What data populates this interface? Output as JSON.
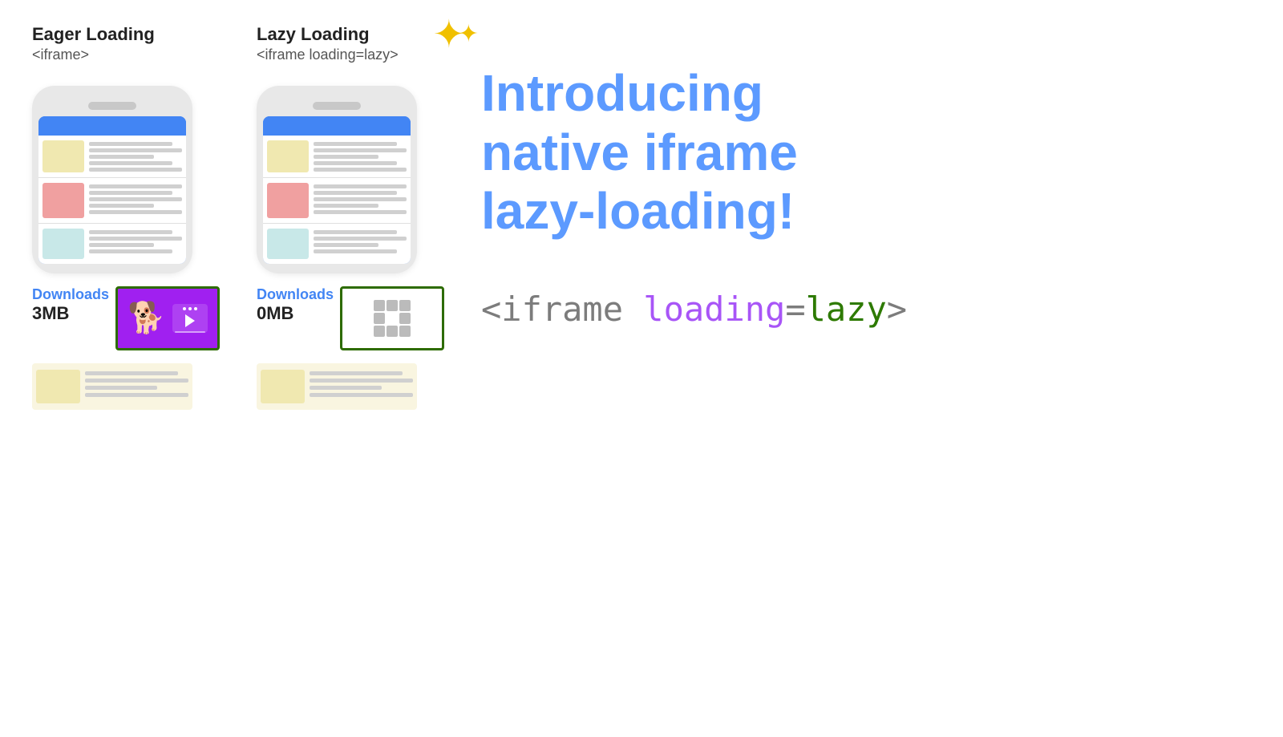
{
  "eager": {
    "label": "Eager Loading",
    "code": "<iframe>",
    "downloads_text": "Downloads",
    "downloads_mb": "3MB"
  },
  "lazy": {
    "label": "Lazy Loading",
    "code": "<iframe loading=lazy>",
    "sparkle": "✦✦",
    "downloads_text": "Downloads",
    "downloads_mb": "0MB"
  },
  "intro": {
    "line1": "Introducing",
    "line2": "native iframe",
    "line3": "lazy-loading!"
  },
  "code_snippet": {
    "prefix": "<iframe ",
    "loading_attr": "loading",
    "equals": "=",
    "lazy_val": "lazy",
    "suffix": ">"
  }
}
